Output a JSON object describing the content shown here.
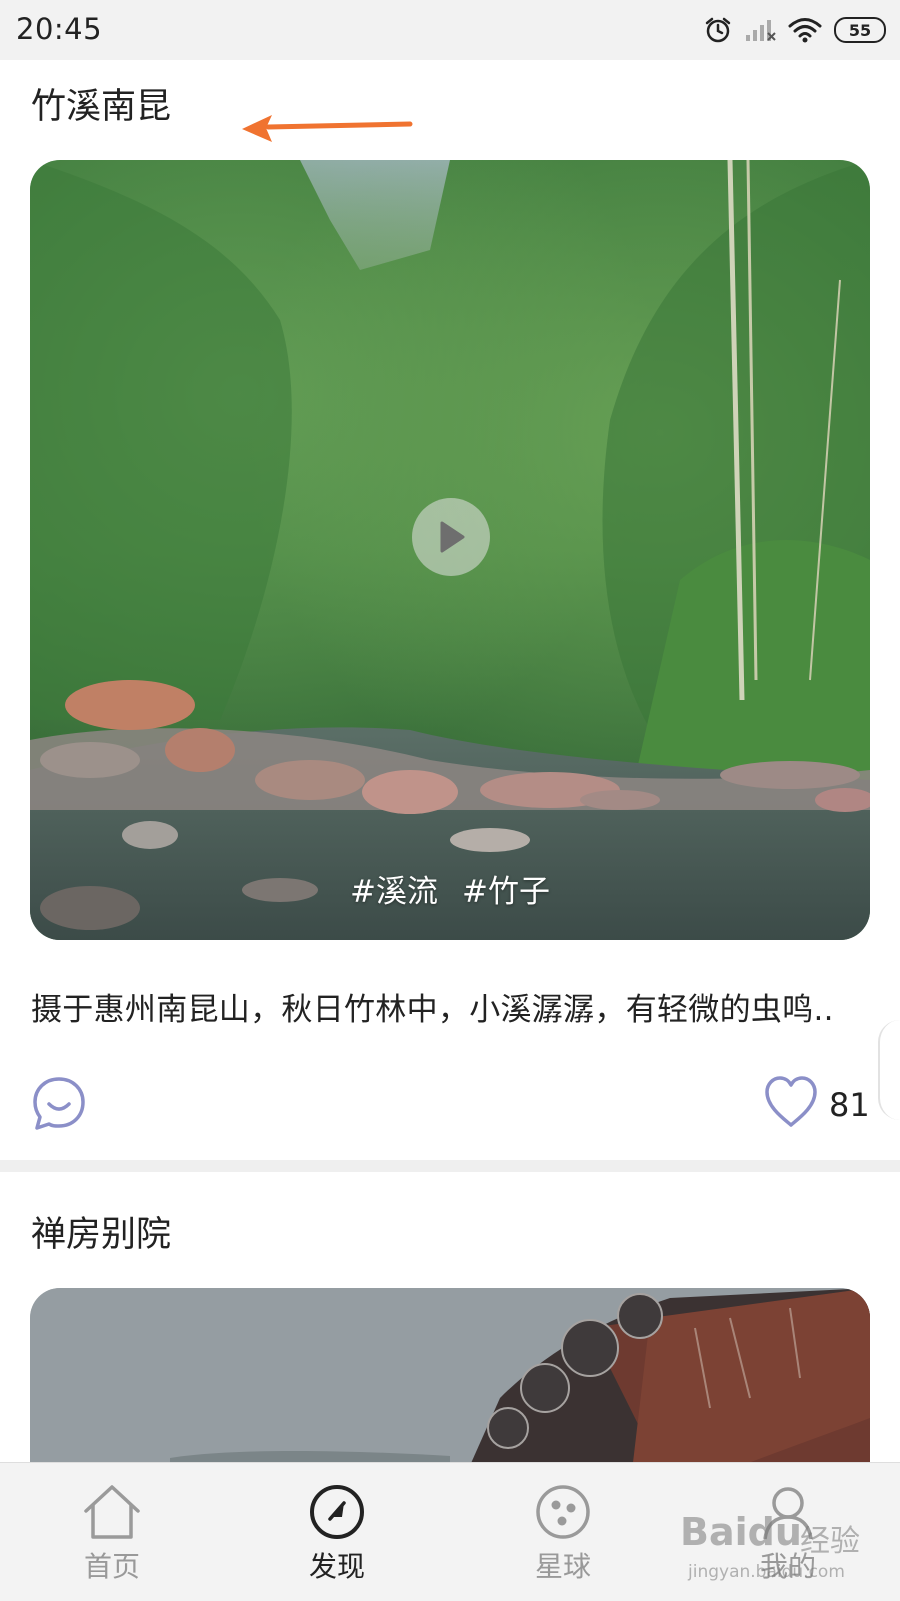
{
  "status_bar": {
    "time": "20:45",
    "battery": "55",
    "icons": [
      "alarm-icon",
      "signal-icon",
      "wifi-icon",
      "battery-icon"
    ]
  },
  "annotation": {
    "arrow_color": "#f07330"
  },
  "posts": [
    {
      "title": "竹溪南昆",
      "tags": [
        "#溪流",
        "#竹子"
      ],
      "description": "摄于惠州南昆山，秋日竹林中，小溪潺潺，有轻微的虫鸣..",
      "likes": "81"
    },
    {
      "title": "禅房别院"
    }
  ],
  "tab_bar": {
    "tabs": [
      {
        "label": "首页",
        "icon": "home-icon",
        "active": false
      },
      {
        "label": "发现",
        "icon": "compass-icon",
        "active": true
      },
      {
        "label": "星球",
        "icon": "planet-icon",
        "active": false
      },
      {
        "label": "我的",
        "icon": "person-icon",
        "active": false
      }
    ]
  },
  "watermark": {
    "logo": "Baidu",
    "text": "经验",
    "url": "jingyan.baidu.com"
  },
  "colors": {
    "icon_accent": "#8b8fc8",
    "status_bar_bg": "#f2f2f2",
    "tab_bar_bg": "#f3f3f3"
  }
}
